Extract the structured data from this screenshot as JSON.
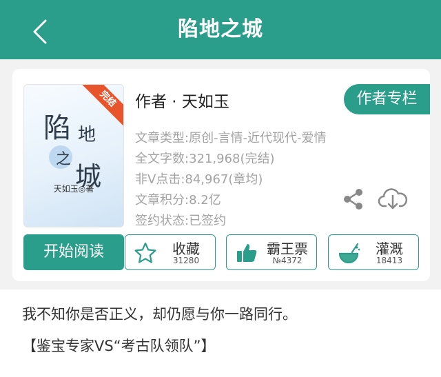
{
  "header": {
    "title": "陷地之城",
    "back_icon": "chevron-left-icon"
  },
  "book": {
    "cover": {
      "ribbon": "完结",
      "title_chars": [
        "陷",
        "地",
        "之",
        "城"
      ],
      "author": "天如玉◎著"
    },
    "author_line": "作者 · 天如玉",
    "author_column_button": "作者专栏",
    "meta": [
      "文章类型:原创-言情-近代现代-爱情",
      "全文字数:321,968(完结)",
      "非V点击:84,967(章均)",
      "文章积分:8.2亿",
      "签约状态:已签约"
    ],
    "share_icon": "share-icon",
    "download_icon": "cloud-download-icon"
  },
  "actions": {
    "read_button": "开始阅读",
    "collect": {
      "label": "收藏",
      "count": "31280",
      "icon": "star-icon"
    },
    "bawangpiao": {
      "label": "霸王票",
      "count": "№4372",
      "icon": "thumbs-up-icon"
    },
    "irrigate": {
      "label": "灌溉",
      "count": "18413",
      "icon": "watering-icon"
    }
  },
  "description": {
    "line1": "我不知你是否正义，却仍愿与你一路同行。",
    "line2": "【鉴宝专家VS“考古队领队”】"
  },
  "colors": {
    "accent": "#2a9e8a",
    "ribbon": "#e8542c",
    "meta_text": "#a3a3a3"
  }
}
